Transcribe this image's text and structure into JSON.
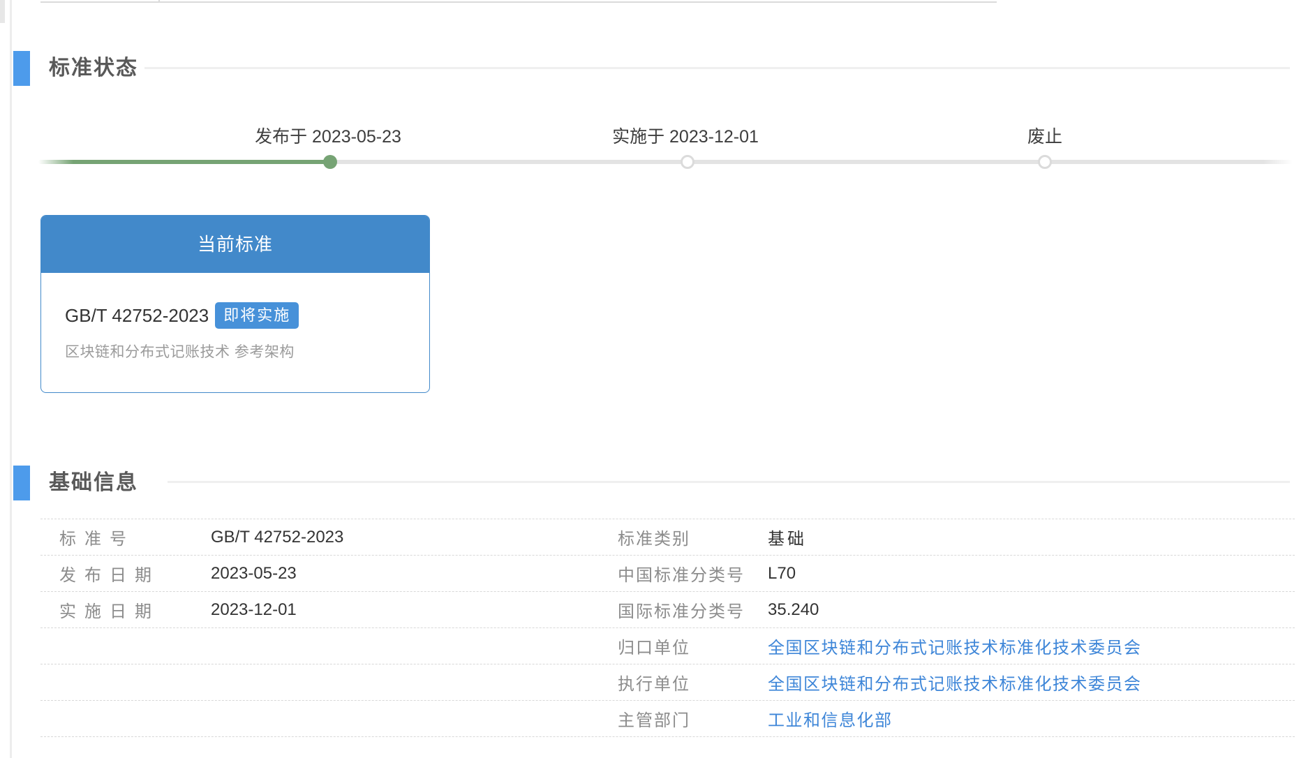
{
  "colors": {
    "section_marker_blue": "#4D9BEB",
    "card_blue": "#4289CA",
    "badge_blue": "#4791D9",
    "timeline_green": "#76A374",
    "timeline_gray": "#E3E3E3",
    "link_blue": "#3E86D8",
    "label_gray": "#8C8C8C",
    "dashed_line": "#D8D8D8"
  },
  "status_section": {
    "title": "标准状态",
    "timeline": [
      {
        "label": "发布于 2023-05-23",
        "state": "done"
      },
      {
        "label": "实施于 2023-12-01",
        "state": "pending"
      },
      {
        "label": "废止",
        "state": "pending"
      }
    ],
    "card": {
      "header": "当前标准",
      "code": "GB/T 42752-2023",
      "badge": "即将实施",
      "name": "区块链和分布式记账技术 参考架构"
    }
  },
  "info_section": {
    "title": "基础信息",
    "rows": [
      {
        "l_label": "标准号",
        "l_value": "GB/T 42752-2023",
        "r_label": "标准类别",
        "r_value": "基础"
      },
      {
        "l_label": "发布日期",
        "l_value": "2023-05-23",
        "r_label": "中国标准分类号",
        "r_value": "L70"
      },
      {
        "l_label": "实施日期",
        "l_value": "2023-12-01",
        "r_label": "国际标准分类号",
        "r_value": "35.240"
      },
      {
        "r_label": "归口单位",
        "r_value": "全国区块链和分布式记账技术标准化技术委员会"
      },
      {
        "r_label": "执行单位",
        "r_value": "全国区块链和分布式记账技术标准化技术委员会"
      },
      {
        "r_label": "主管部门",
        "r_value": "工业和信息化部"
      }
    ]
  }
}
